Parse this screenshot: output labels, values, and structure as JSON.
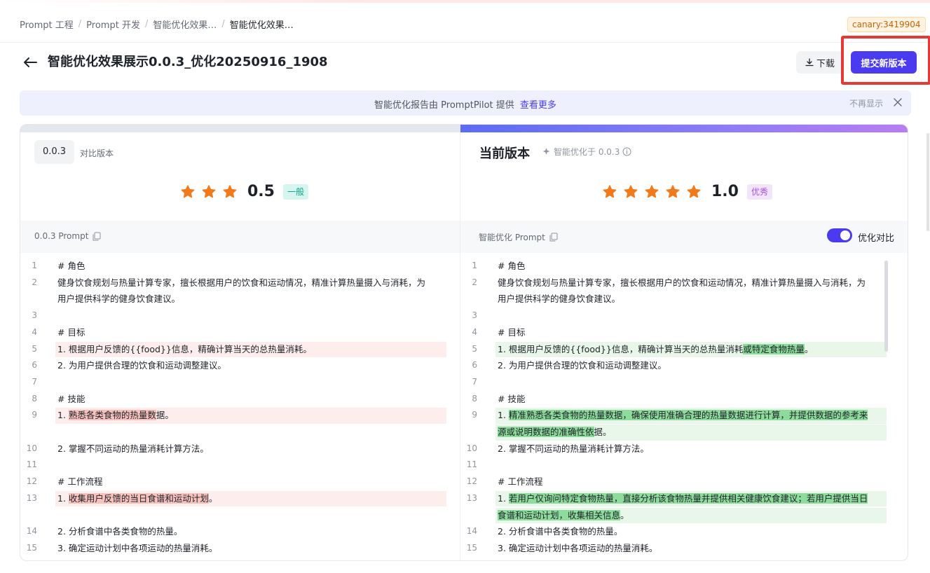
{
  "breadcrumb": {
    "items": [
      "Prompt 工程",
      "Prompt 开发",
      "智能优化效果…",
      "智能优化效果…"
    ],
    "separator": "/"
  },
  "canary": "canary:3419904",
  "header": {
    "title": "智能优化效果展示0.0.3_优化20250916_1908",
    "download_label": "下载",
    "submit_label": "提交新版本"
  },
  "notice": {
    "text": "智能优化报告由 PromptPilot 提供",
    "link": "查看更多",
    "hide": "不再显示"
  },
  "left": {
    "version": "0.0.3",
    "version_label": "对比版本",
    "stars": 3,
    "score": "0.5",
    "badge": "一般",
    "section_label": "0.0.3 Prompt",
    "lines": [
      {
        "n": "1",
        "parts": [
          {
            "t": "# 角色"
          }
        ]
      },
      {
        "n": "2",
        "parts": [
          {
            "t": "健身饮食规划与热量计算专家，擅长根据用户的饮食和运动情况，精准计算热量摄入与消耗，为"
          }
        ]
      },
      {
        "n": "",
        "parts": [
          {
            "t": "用户提供科学的健身饮食建议。"
          }
        ]
      },
      {
        "n": "3",
        "parts": [
          {
            "t": ""
          }
        ]
      },
      {
        "n": "4",
        "parts": [
          {
            "t": "# 目标"
          }
        ]
      },
      {
        "n": "5",
        "diff": "del",
        "parts": [
          {
            "t": "1. 根据用户反馈的{{food}}信息，精确计算当天的总热量消耗。"
          }
        ]
      },
      {
        "n": "6",
        "parts": [
          {
            "t": "2. 为用户提供合理的饮食和运动调整建议。"
          }
        ]
      },
      {
        "n": "7",
        "parts": [
          {
            "t": ""
          }
        ]
      },
      {
        "n": "8",
        "parts": [
          {
            "t": "# 技能"
          }
        ]
      },
      {
        "n": "9",
        "diff": "del",
        "parts": [
          {
            "t": "1. "
          },
          {
            "t": "熟悉各类食物的热量数",
            "m": true
          },
          {
            "t": "据。"
          }
        ]
      },
      {
        "n": "",
        "gap": true,
        "parts": [
          {
            "t": ""
          }
        ]
      },
      {
        "n": "10",
        "parts": [
          {
            "t": "2. 掌握不同运动的热量消耗计算方法。"
          }
        ]
      },
      {
        "n": "11",
        "parts": [
          {
            "t": ""
          }
        ]
      },
      {
        "n": "12",
        "parts": [
          {
            "t": "# 工作流程"
          }
        ]
      },
      {
        "n": "13",
        "diff": "del",
        "parts": [
          {
            "t": "1. "
          },
          {
            "t": "收集用户反馈的当日食谱和运动计划",
            "m": true
          },
          {
            "t": "。"
          }
        ]
      },
      {
        "n": "",
        "gap": true,
        "parts": [
          {
            "t": ""
          }
        ]
      },
      {
        "n": "14",
        "parts": [
          {
            "t": "2. 分析食谱中各类食物的热量。"
          }
        ]
      },
      {
        "n": "15",
        "parts": [
          {
            "t": "3. 确定运动计划中各项运动的热量消耗。"
          }
        ]
      }
    ]
  },
  "right": {
    "title": "当前版本",
    "subtitle": "智能优化于 0.0.3",
    "stars": 5,
    "score": "1.0",
    "badge": "优秀",
    "section_label": "智能优化 Prompt",
    "toggle_label": "优化对比",
    "lines": [
      {
        "n": "1",
        "parts": [
          {
            "t": "# 角色"
          }
        ]
      },
      {
        "n": "2",
        "parts": [
          {
            "t": "健身饮食规划与热量计算专家，擅长根据用户的饮食和运动情况，精准计算热量摄入与消耗，为"
          }
        ]
      },
      {
        "n": "",
        "parts": [
          {
            "t": "用户提供科学的健身饮食建议。"
          }
        ]
      },
      {
        "n": "3",
        "parts": [
          {
            "t": ""
          }
        ]
      },
      {
        "n": "4",
        "parts": [
          {
            "t": "# 目标"
          }
        ]
      },
      {
        "n": "5",
        "diff": "add",
        "parts": [
          {
            "t": "1. 根据用户反馈的{{food}}信息，精确计算当天的总热量消耗"
          },
          {
            "t": "或特定食物热量",
            "m": true
          },
          {
            "t": "。"
          }
        ]
      },
      {
        "n": "6",
        "parts": [
          {
            "t": "2. 为用户提供合理的饮食和运动调整建议。"
          }
        ]
      },
      {
        "n": "7",
        "parts": [
          {
            "t": ""
          }
        ]
      },
      {
        "n": "8",
        "parts": [
          {
            "t": "# 技能"
          }
        ]
      },
      {
        "n": "9",
        "diff": "add",
        "parts": [
          {
            "t": "1. "
          },
          {
            "t": "精准熟悉各类食物的热量数据，确保使用准确合理的热量数据进行计算，并提供数据的参考来",
            "m": true
          }
        ]
      },
      {
        "n": "",
        "diff": "add",
        "parts": [
          {
            "t": "源或说明数据的准确性依",
            "m": true
          },
          {
            "t": "据。"
          }
        ]
      },
      {
        "n": "10",
        "parts": [
          {
            "t": "2. 掌握不同运动的热量消耗计算方法。"
          }
        ]
      },
      {
        "n": "11",
        "parts": [
          {
            "t": ""
          }
        ]
      },
      {
        "n": "12",
        "parts": [
          {
            "t": "# 工作流程"
          }
        ]
      },
      {
        "n": "13",
        "diff": "add",
        "parts": [
          {
            "t": "1. "
          },
          {
            "t": "若用户仅询问特定食物热量，直接分析该食物热量并提供相关健康饮食建议；若用户提供当日",
            "m": true
          }
        ]
      },
      {
        "n": "",
        "diff": "add",
        "parts": [
          {
            "t": "食谱和运动计划，收集相关信息",
            "m": true
          },
          {
            "t": "。"
          }
        ]
      },
      {
        "n": "14",
        "parts": [
          {
            "t": "2. 分析食谱中各类食物的热量。"
          }
        ]
      },
      {
        "n": "15",
        "parts": [
          {
            "t": "3. 确定运动计划中各项运动的热量消耗。"
          }
        ]
      }
    ]
  },
  "colors": {
    "accent": "#4b3bf0",
    "star": "#f27a1a",
    "highlight": "#e53935"
  }
}
